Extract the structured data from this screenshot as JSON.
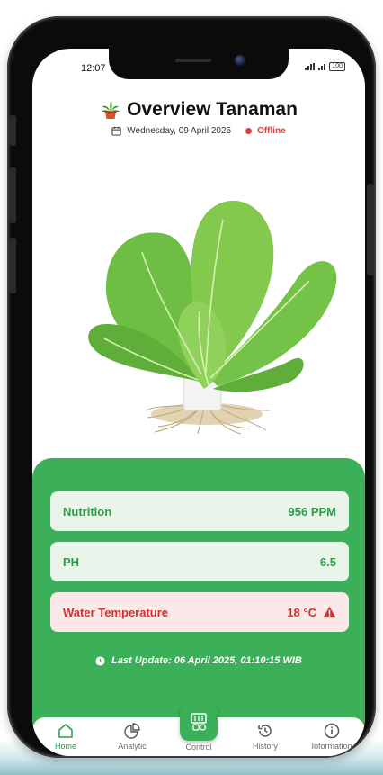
{
  "status_bar": {
    "time": "12:07",
    "battery": "100"
  },
  "header": {
    "title": "Overview Tanaman",
    "date": "Wednesday, 09 April 2025",
    "connection_status": "Offline"
  },
  "icons": {
    "title": "potted-plant-icon",
    "date": "calendar-icon",
    "connection": "status-dot-icon",
    "warning": "warning-triangle-icon",
    "last_update": "clock-icon"
  },
  "colors": {
    "primary_green": "#3cb058",
    "card_green_bg": "#e9f4ea",
    "card_green_text": "#2f9a48",
    "card_red_bg": "#fbe9ea",
    "card_red_text": "#d32f2f",
    "offline_red": "#e53935"
  },
  "readings": [
    {
      "label": "Nutrition",
      "value": "956 PPM",
      "state": "normal"
    },
    {
      "label": "PH",
      "value": "6.5",
      "state": "normal"
    },
    {
      "label": "Water Temperature",
      "value": "18 °C",
      "state": "alert"
    }
  ],
  "last_update": "Last Update:  06 April 2025, 01:10:15 WIB",
  "nav": [
    {
      "label": "Home",
      "icon": "home-icon",
      "active": true
    },
    {
      "label": "Analytic",
      "icon": "pie-chart-icon",
      "active": false
    },
    {
      "label": "Control",
      "icon": "control-panel-icon",
      "active": false
    },
    {
      "label": "History",
      "icon": "history-icon",
      "active": false
    },
    {
      "label": "Information",
      "icon": "info-icon",
      "active": false
    }
  ]
}
